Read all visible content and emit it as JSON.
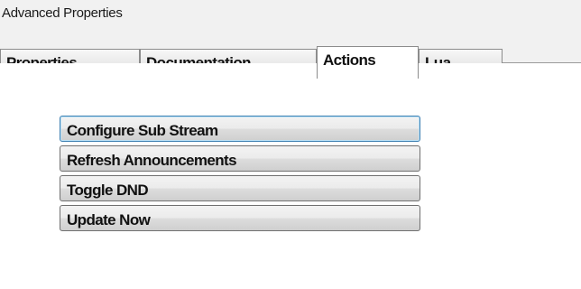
{
  "panel": {
    "title": "Advanced Properties"
  },
  "tabs": [
    {
      "label": "Properties",
      "active": false
    },
    {
      "label": "Documentation",
      "active": false
    },
    {
      "label": "Actions",
      "active": true
    },
    {
      "label": "Lua",
      "active": false
    }
  ],
  "actions": [
    {
      "label": "Configure Sub Stream",
      "focused": true
    },
    {
      "label": "Refresh Announcements",
      "focused": false
    },
    {
      "label": "Toggle DND",
      "focused": false
    },
    {
      "label": "Update Now",
      "focused": false
    }
  ],
  "colors": {
    "focus_border": "#3c7fb1",
    "header_background": "#f1f1f1"
  }
}
